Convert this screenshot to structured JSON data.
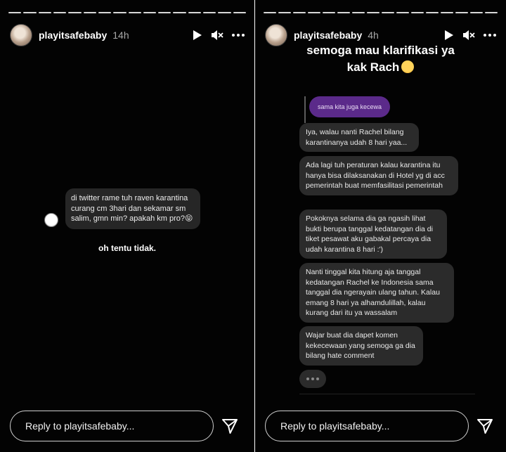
{
  "left_story": {
    "username": "playitsafebaby",
    "time": "14h",
    "question": "di twitter rame tuh raven karantina curang cm 3hari dan sekamar sm salim, gmn min? apakah km pro?",
    "question_emoji": "😝",
    "answer": "oh tentu tidak.",
    "reply_placeholder": "Reply to playitsafebaby..."
  },
  "right_story": {
    "username": "playitsafebaby",
    "time": "4h",
    "caption_line1": "semoga mau klarifikasi ya",
    "caption_line2": "kak Rach",
    "caption_emoji": "🥰",
    "quoted_message": "sama kita juga kecewa",
    "messages": [
      "Iya, walau nanti Rachel bilang karantinanya udah 8 hari yaa...",
      "Ada lagi tuh peraturan kalau karantina itu hanya bisa dilaksanakan di Hotel yg di acc pemerintah buat memfasilitasi pemerintah",
      "Pokoknya selama dia ga ngasih lihat bukti berupa tanggal kedatangan dia di tiket pesawat aku gabakal percaya dia udah karantina 8 hari :')",
      "Nanti tinggal kita hitung aja tanggal kedatangan Rachel ke Indonesia sama tanggal dia ngerayain ulang tahun. Kalau emang 8 hari ya alhamdulillah, kalau kurang dari itu ya wassalam",
      "Wajar buat dia dapet komen kekecewaan yang semoga ga dia bilang hate comment"
    ],
    "reply_placeholder": "Reply to playitsafebaby..."
  },
  "icons": {
    "play": "play-icon",
    "mute": "speaker-muted-icon",
    "more": "more-icon",
    "send": "send-icon",
    "typing": "typing-indicator"
  },
  "colors": {
    "background": "#030303",
    "bubble": "#2b2b2b",
    "purple_bubble": "#5b2a8a",
    "text": "#ffffff"
  }
}
